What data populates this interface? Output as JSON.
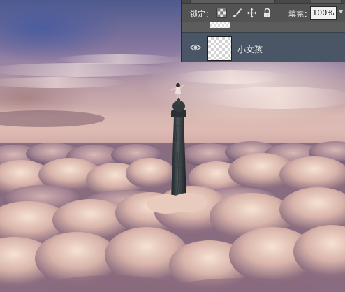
{
  "layers_panel": {
    "lock_label": "锁定：",
    "lock_icons": [
      "lock-transparent-pixels-icon",
      "lock-image-pixels-icon",
      "lock-position-icon",
      "lock-all-icon"
    ],
    "fill_label": "填充：",
    "fill_value": "100%",
    "layers": [
      {
        "name": "",
        "visible": false
      },
      {
        "name": "小女孩",
        "visible": true,
        "selected": true
      }
    ],
    "colors": {
      "panel_bg": "#535353",
      "selected_row": "#4a5666",
      "text": "#e0e0e0"
    }
  },
  "canvas": {
    "subject": "photo",
    "colors": {
      "sky_top": "#4e5a8e",
      "sky_mid": "#d6b4b0",
      "cloud_light": "#f3dccd",
      "cloud_shadow": "#8f6f7f"
    }
  }
}
